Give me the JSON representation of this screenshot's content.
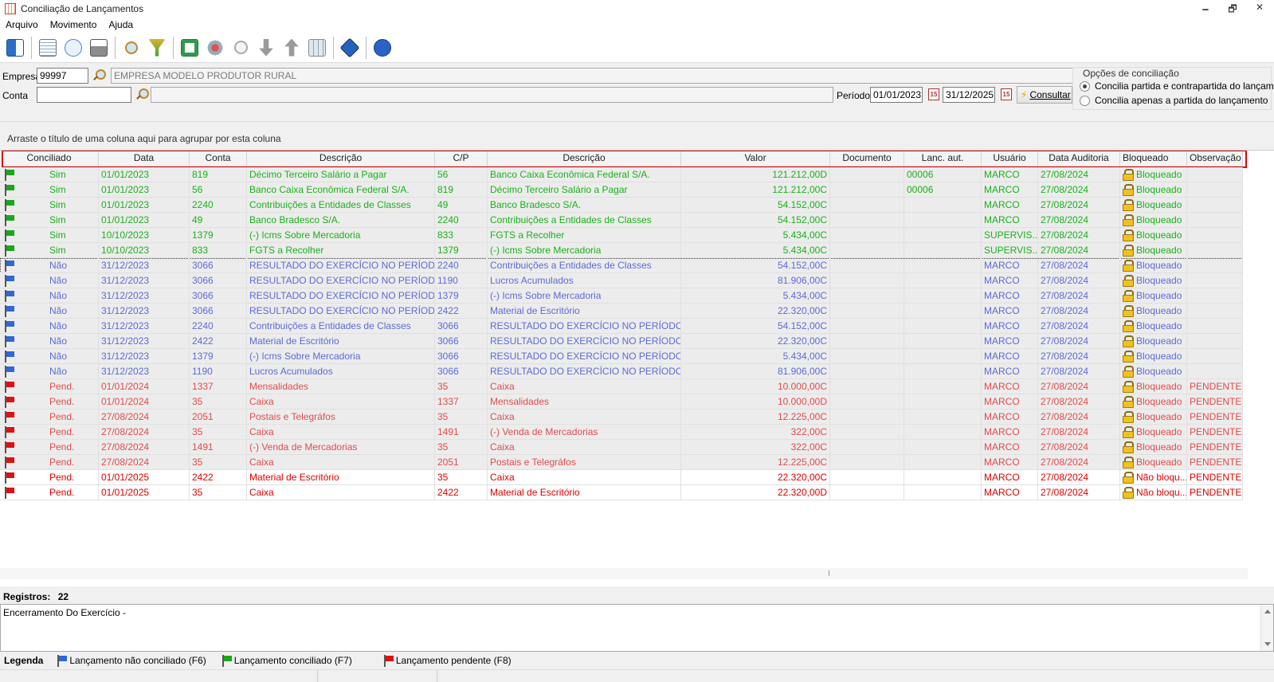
{
  "window": {
    "title": "Conciliação de Lançamentos",
    "minimize": "🗕",
    "restore": "🗗",
    "close": "✕"
  },
  "menu": [
    "Arquivo",
    "Movimento",
    "Ajuda"
  ],
  "toolbar_icons": [
    "exit-icon",
    "edit-icon",
    "preview-icon",
    "print-icon",
    "search-icon",
    "filter-icon",
    "excel-icon",
    "conciliate-icon",
    "zoom-icon",
    "move-down-icon",
    "move-up-icon",
    "grid-icon",
    "info-icon",
    "help-icon"
  ],
  "filters": {
    "empresa_label": "Empresa",
    "empresa_code": "99997",
    "empresa_name": "EMPRESA MODELO PRODUTOR RURAL",
    "conta_label": "Conta",
    "conta_code": "",
    "conta_name": "",
    "periodo_label": "Período",
    "periodo_inicio": "01/01/2023",
    "periodo_fim": "31/12/2025",
    "consultar_label": "Consultar",
    "calendar_icon_text": "15"
  },
  "options": {
    "title": "Opções de conciliação",
    "option1": "Concilia partida e contrapartida do lançamento",
    "option2": "Concilia apenas a partida do lançamento",
    "selected": 1
  },
  "group_hint": "Arraste o título de uma coluna aqui para agrupar por esta coluna",
  "columns": [
    "Conciliado",
    "Data",
    "Conta",
    "Descrição",
    "C/P",
    "Descrição",
    "Valor",
    "Documento",
    "Lanc. aut.",
    "Usuário",
    "Data Auditoria",
    "Bloqueado",
    "Observação"
  ],
  "rows": [
    {
      "status": "sim",
      "flag": "green",
      "conciliado": "Sim",
      "data": "01/01/2023",
      "conta": "819",
      "descricao": "Décimo Terceiro Salário a Pagar",
      "cp": "56",
      "descricao_cp": "Banco Caixa Econômica Federal S/A.",
      "valor": "121.212,00D",
      "documento": "",
      "lanc_aut": "00006",
      "usuario": "MARCO",
      "data_auditoria": "27/08/2024",
      "bloqueado": "Bloqueado",
      "observacao": ""
    },
    {
      "status": "sim",
      "flag": "green",
      "conciliado": "Sim",
      "data": "01/01/2023",
      "conta": "56",
      "descricao": "Banco Caixa Econômica Federal S/A.",
      "cp": "819",
      "descricao_cp": "Décimo Terceiro Salário a Pagar",
      "valor": "121.212,00C",
      "documento": "",
      "lanc_aut": "00006",
      "usuario": "MARCO",
      "data_auditoria": "27/08/2024",
      "bloqueado": "Bloqueado",
      "observacao": ""
    },
    {
      "status": "sim",
      "flag": "green",
      "conciliado": "Sim",
      "data": "01/01/2023",
      "conta": "2240",
      "descricao": "Contribuições a Entidades de Classes",
      "cp": "49",
      "descricao_cp": "Banco Bradesco S/A.",
      "valor": "54.152,00C",
      "documento": "",
      "lanc_aut": "",
      "usuario": "MARCO",
      "data_auditoria": "27/08/2024",
      "bloqueado": "Bloqueado",
      "observacao": ""
    },
    {
      "status": "sim",
      "flag": "green",
      "conciliado": "Sim",
      "data": "01/01/2023",
      "conta": "49",
      "descricao": "Banco Bradesco S/A.",
      "cp": "2240",
      "descricao_cp": "Contribuições a Entidades de Classes",
      "valor": "54.152,00C",
      "documento": "",
      "lanc_aut": "",
      "usuario": "MARCO",
      "data_auditoria": "27/08/2024",
      "bloqueado": "Bloqueado",
      "observacao": ""
    },
    {
      "status": "sim",
      "flag": "green",
      "conciliado": "Sim",
      "data": "10/10/2023",
      "conta": "1379",
      "descricao": "(-) Icms Sobre Mercadoria",
      "cp": "833",
      "descricao_cp": "FGTS a Recolher",
      "valor": "5.434,00C",
      "documento": "",
      "lanc_aut": "",
      "usuario": "SUPERVIS...",
      "data_auditoria": "27/08/2024",
      "bloqueado": "Bloqueado",
      "observacao": ""
    },
    {
      "status": "sim",
      "flag": "green",
      "conciliado": "Sim",
      "data": "10/10/2023",
      "conta": "833",
      "descricao": "FGTS a Recolher",
      "cp": "1379",
      "descricao_cp": "(-) Icms Sobre Mercadoria",
      "valor": "5.434,00C",
      "documento": "",
      "lanc_aut": "",
      "usuario": "SUPERVIS...",
      "data_auditoria": "27/08/2024",
      "bloqueado": "Bloqueado",
      "observacao": ""
    },
    {
      "status": "nao",
      "flag": "blue",
      "conciliado": "Não",
      "data": "31/12/2023",
      "conta": "3066",
      "descricao": "RESULTADO DO EXERCÍCIO NO PERÍODO",
      "cp": "2240",
      "descricao_cp": "Contribuições a Entidades de Classes",
      "valor": "54.152,00C",
      "documento": "",
      "lanc_aut": "",
      "usuario": "MARCO",
      "data_auditoria": "27/08/2024",
      "bloqueado": "Bloqueado",
      "observacao": "",
      "focus": true
    },
    {
      "status": "nao",
      "flag": "blue",
      "conciliado": "Não",
      "data": "31/12/2023",
      "conta": "3066",
      "descricao": "RESULTADO DO EXERCÍCIO NO PERÍODO",
      "cp": "1190",
      "descricao_cp": "Lucros Acumulados",
      "valor": "81.906,00C",
      "documento": "",
      "lanc_aut": "",
      "usuario": "MARCO",
      "data_auditoria": "27/08/2024",
      "bloqueado": "Bloqueado",
      "observacao": ""
    },
    {
      "status": "nao",
      "flag": "blue",
      "conciliado": "Não",
      "data": "31/12/2023",
      "conta": "3066",
      "descricao": "RESULTADO DO EXERCÍCIO NO PERÍODO",
      "cp": "1379",
      "descricao_cp": "(-) Icms Sobre Mercadoria",
      "valor": "5.434,00C",
      "documento": "",
      "lanc_aut": "",
      "usuario": "MARCO",
      "data_auditoria": "27/08/2024",
      "bloqueado": "Bloqueado",
      "observacao": ""
    },
    {
      "status": "nao",
      "flag": "blue",
      "conciliado": "Não",
      "data": "31/12/2023",
      "conta": "3066",
      "descricao": "RESULTADO DO EXERCÍCIO NO PERÍODO",
      "cp": "2422",
      "descricao_cp": "Material de Escritório",
      "valor": "22.320,00C",
      "documento": "",
      "lanc_aut": "",
      "usuario": "MARCO",
      "data_auditoria": "27/08/2024",
      "bloqueado": "Bloqueado",
      "observacao": ""
    },
    {
      "status": "nao",
      "flag": "blue",
      "conciliado": "Não",
      "data": "31/12/2023",
      "conta": "2240",
      "descricao": "Contribuições a Entidades de Classes",
      "cp": "3066",
      "descricao_cp": "RESULTADO DO EXERCÍCIO NO PERÍODO",
      "valor": "54.152,00C",
      "documento": "",
      "lanc_aut": "",
      "usuario": "MARCO",
      "data_auditoria": "27/08/2024",
      "bloqueado": "Bloqueado",
      "observacao": ""
    },
    {
      "status": "nao",
      "flag": "blue",
      "conciliado": "Não",
      "data": "31/12/2023",
      "conta": "2422",
      "descricao": "Material de Escritório",
      "cp": "3066",
      "descricao_cp": "RESULTADO DO EXERCÍCIO NO PERÍODO",
      "valor": "22.320,00C",
      "documento": "",
      "lanc_aut": "",
      "usuario": "MARCO",
      "data_auditoria": "27/08/2024",
      "bloqueado": "Bloqueado",
      "observacao": ""
    },
    {
      "status": "nao",
      "flag": "blue",
      "conciliado": "Não",
      "data": "31/12/2023",
      "conta": "1379",
      "descricao": "(-) Icms Sobre Mercadoria",
      "cp": "3066",
      "descricao_cp": "RESULTADO DO EXERCÍCIO NO PERÍODO",
      "valor": "5.434,00C",
      "documento": "",
      "lanc_aut": "",
      "usuario": "MARCO",
      "data_auditoria": "27/08/2024",
      "bloqueado": "Bloqueado",
      "observacao": ""
    },
    {
      "status": "nao",
      "flag": "blue",
      "conciliado": "Não",
      "data": "31/12/2023",
      "conta": "1190",
      "descricao": "Lucros Acumulados",
      "cp": "3066",
      "descricao_cp": "RESULTADO DO EXERCÍCIO NO PERÍODO",
      "valor": "81.906,00C",
      "documento": "",
      "lanc_aut": "",
      "usuario": "MARCO",
      "data_auditoria": "27/08/2024",
      "bloqueado": "Bloqueado",
      "observacao": ""
    },
    {
      "status": "pend",
      "flag": "red",
      "conciliado": "Pend.",
      "data": "01/01/2024",
      "conta": "1337",
      "descricao": "Mensalidades",
      "cp": "35",
      "descricao_cp": "Caixa",
      "valor": "10.000,00C",
      "documento": "",
      "lanc_aut": "",
      "usuario": "MARCO",
      "data_auditoria": "27/08/2024",
      "bloqueado": "Bloqueado",
      "observacao": "PENDENTE"
    },
    {
      "status": "pend",
      "flag": "red",
      "conciliado": "Pend.",
      "data": "01/01/2024",
      "conta": "35",
      "descricao": "Caixa",
      "cp": "1337",
      "descricao_cp": "Mensalidades",
      "valor": "10.000,00D",
      "documento": "",
      "lanc_aut": "",
      "usuario": "MARCO",
      "data_auditoria": "27/08/2024",
      "bloqueado": "Bloqueado",
      "observacao": "PENDENTE"
    },
    {
      "status": "pend",
      "flag": "red",
      "conciliado": "Pend.",
      "data": "27/08/2024",
      "conta": "2051",
      "descricao": "Postais e Telegráfos",
      "cp": "35",
      "descricao_cp": "Caixa",
      "valor": "12.225,00C",
      "documento": "",
      "lanc_aut": "",
      "usuario": "MARCO",
      "data_auditoria": "27/08/2024",
      "bloqueado": "Bloqueado",
      "observacao": "PENDENTE"
    },
    {
      "status": "pend",
      "flag": "red",
      "conciliado": "Pend.",
      "data": "27/08/2024",
      "conta": "35",
      "descricao": "Caixa",
      "cp": "1491",
      "descricao_cp": "(-) Venda de Mercadorias",
      "valor": "322,00C",
      "documento": "",
      "lanc_aut": "",
      "usuario": "MARCO",
      "data_auditoria": "27/08/2024",
      "bloqueado": "Bloqueado",
      "observacao": "PENDENTE"
    },
    {
      "status": "pend",
      "flag": "red",
      "conciliado": "Pend.",
      "data": "27/08/2024",
      "conta": "1491",
      "descricao": "(-) Venda de Mercadorias",
      "cp": "35",
      "descricao_cp": "Caixa",
      "valor": "322,00C",
      "documento": "",
      "lanc_aut": "",
      "usuario": "MARCO",
      "data_auditoria": "27/08/2024",
      "bloqueado": "Bloqueado",
      "observacao": "PENDENTE"
    },
    {
      "status": "pend",
      "flag": "red",
      "conciliado": "Pend.",
      "data": "27/08/2024",
      "conta": "35",
      "descricao": "Caixa",
      "cp": "2051",
      "descricao_cp": "Postais e Telegráfos",
      "valor": "12.225,00C",
      "documento": "",
      "lanc_aut": "",
      "usuario": "MARCO",
      "data_auditoria": "27/08/2024",
      "bloqueado": "Bloqueado",
      "observacao": "PENDENTE"
    },
    {
      "status": "pend2",
      "flag": "red",
      "conciliado": "Pend.",
      "data": "01/01/2025",
      "conta": "2422",
      "descricao": "Material de Escritório",
      "cp": "35",
      "descricao_cp": "Caixa",
      "valor": "22.320,00C",
      "documento": "",
      "lanc_aut": "",
      "usuario": "MARCO",
      "data_auditoria": "27/08/2024",
      "bloqueado": "Não bloqu...",
      "observacao": "PENDENTE"
    },
    {
      "status": "pend2",
      "flag": "red",
      "conciliado": "Pend.",
      "data": "01/01/2025",
      "conta": "35",
      "descricao": "Caixa",
      "cp": "2422",
      "descricao_cp": "Material de Escritório",
      "valor": "22.320,00D",
      "documento": "",
      "lanc_aut": "",
      "usuario": "MARCO",
      "data_auditoria": "27/08/2024",
      "bloqueado": "Não bloqu...",
      "observacao": "PENDENTE"
    }
  ],
  "status": {
    "registros_label": "Registros:",
    "registros_count": "22"
  },
  "memo_text": "Encerramento Do Exercício -",
  "legend": {
    "title": "Legenda",
    "nao_conciliado": "Lançamento não conciliado (F6)",
    "conciliado": "Lançamento conciliado (F7)",
    "pendente": "Lançamento pendente (F8)"
  }
}
